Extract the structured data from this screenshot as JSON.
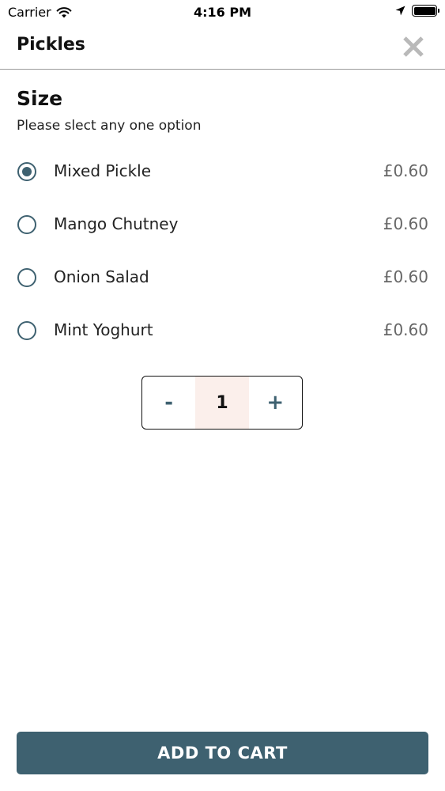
{
  "status_bar": {
    "carrier": "Carrier",
    "time": "4:16 PM"
  },
  "header": {
    "title": "Pickles"
  },
  "section": {
    "title": "Size",
    "subtitle": "Please slect any one option"
  },
  "options": [
    {
      "label": "Mixed Pickle",
      "price": "£0.60",
      "selected": true
    },
    {
      "label": "Mango Chutney",
      "price": "£0.60",
      "selected": false
    },
    {
      "label": "Onion Salad",
      "price": "£0.60",
      "selected": false
    },
    {
      "label": "Mint Yoghurt",
      "price": "£0.60",
      "selected": false
    }
  ],
  "stepper": {
    "minus": "-",
    "value": "1",
    "plus": "+"
  },
  "footer": {
    "add_to_cart_label": "ADD TO CART"
  },
  "colors": {
    "accent": "#3e6170",
    "stepper_value_bg": "#fbefeb",
    "close_icon": "#b9b9b9"
  }
}
